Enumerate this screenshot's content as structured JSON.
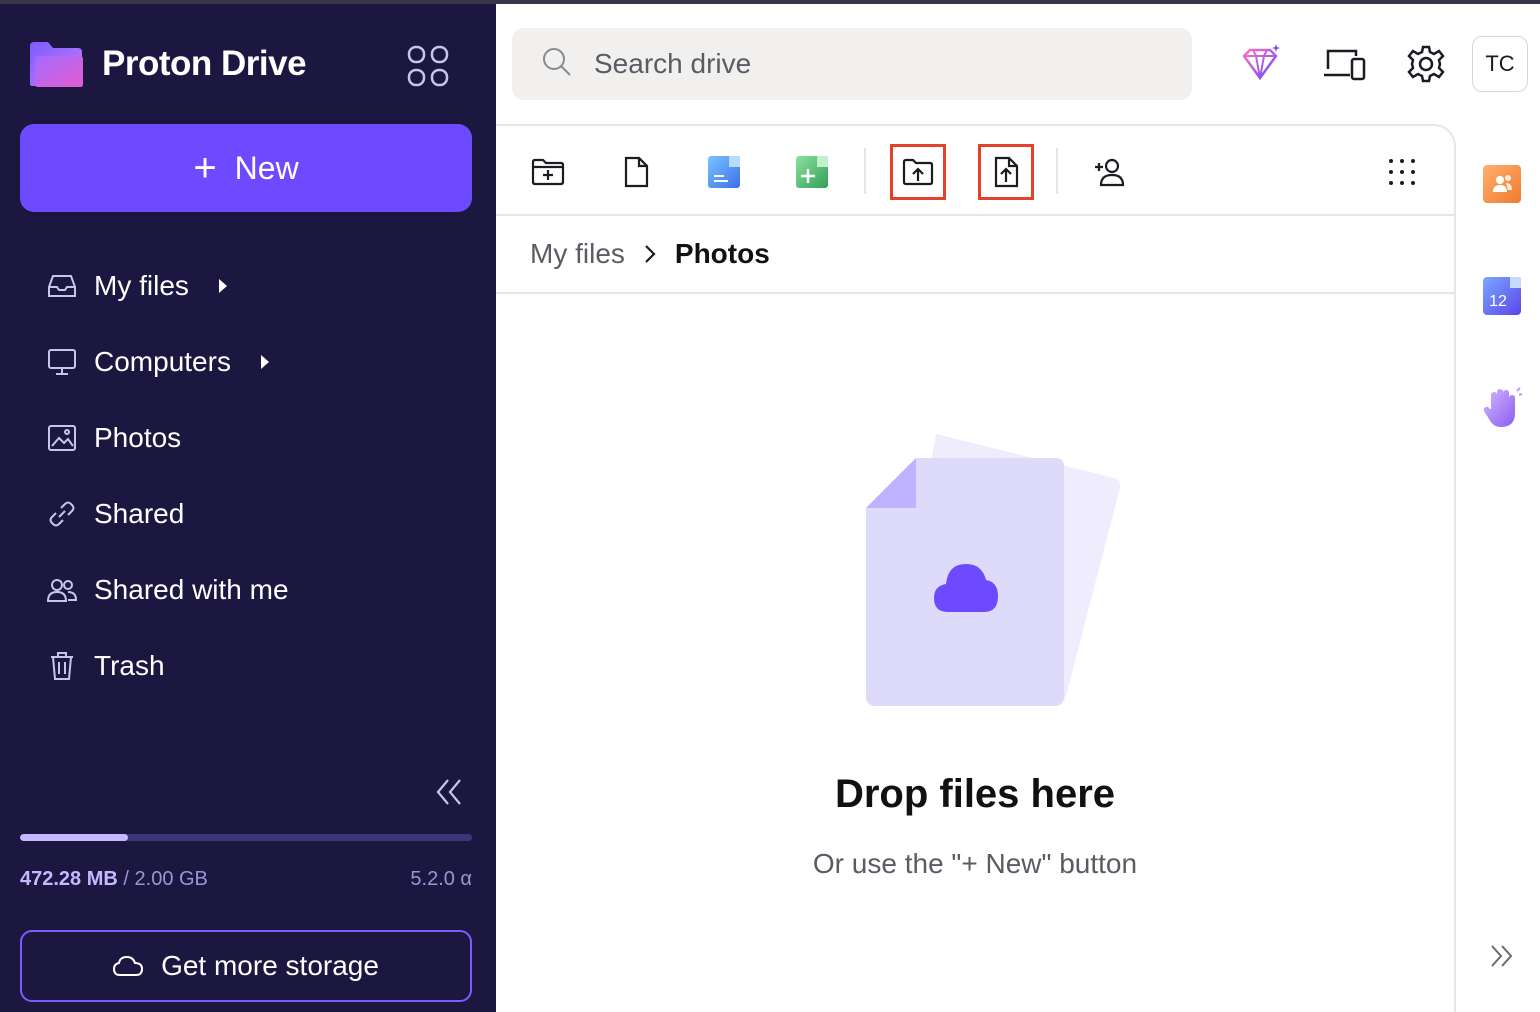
{
  "app": {
    "name": "Proton Drive"
  },
  "sidebar": {
    "new_label": "New",
    "nav": [
      {
        "label": "My files",
        "icon": "inbox-icon",
        "has_caret": true
      },
      {
        "label": "Computers",
        "icon": "monitor-icon",
        "has_caret": true
      },
      {
        "label": "Photos",
        "icon": "image-icon",
        "has_caret": false
      },
      {
        "label": "Shared",
        "icon": "link-icon",
        "has_caret": false
      },
      {
        "label": "Shared with me",
        "icon": "users-icon",
        "has_caret": false
      },
      {
        "label": "Trash",
        "icon": "trash-icon",
        "has_caret": false
      }
    ],
    "storage": {
      "used": "472.28 MB",
      "separator": " / ",
      "total": "2.00 GB",
      "fraction_used": 0.24
    },
    "version": "5.2.0 α",
    "get_storage_label": "Get more storage"
  },
  "header": {
    "search_placeholder": "Search drive",
    "avatar_initials": "TC"
  },
  "toolbar": {
    "buttons": [
      "new-folder-icon",
      "new-file-icon",
      "new-document-icon",
      "new-spreadsheet-icon",
      "upload-folder-icon",
      "upload-file-icon",
      "share-icon",
      "more-grid-icon"
    ],
    "highlighted": [
      "upload-folder-icon",
      "upload-file-icon"
    ]
  },
  "breadcrumb": {
    "parent": "My files",
    "current": "Photos"
  },
  "empty_state": {
    "title": "Drop files here",
    "subtitle": "Or use the \"+ New\" button"
  },
  "rail": {
    "apps": [
      "contacts-icon",
      "calendar-icon",
      "wave-hand-icon"
    ],
    "calendar_day": "12"
  },
  "colors": {
    "sidebar_bg": "#1b1740",
    "accent": "#6d4aff",
    "highlight": "#e2412a"
  }
}
